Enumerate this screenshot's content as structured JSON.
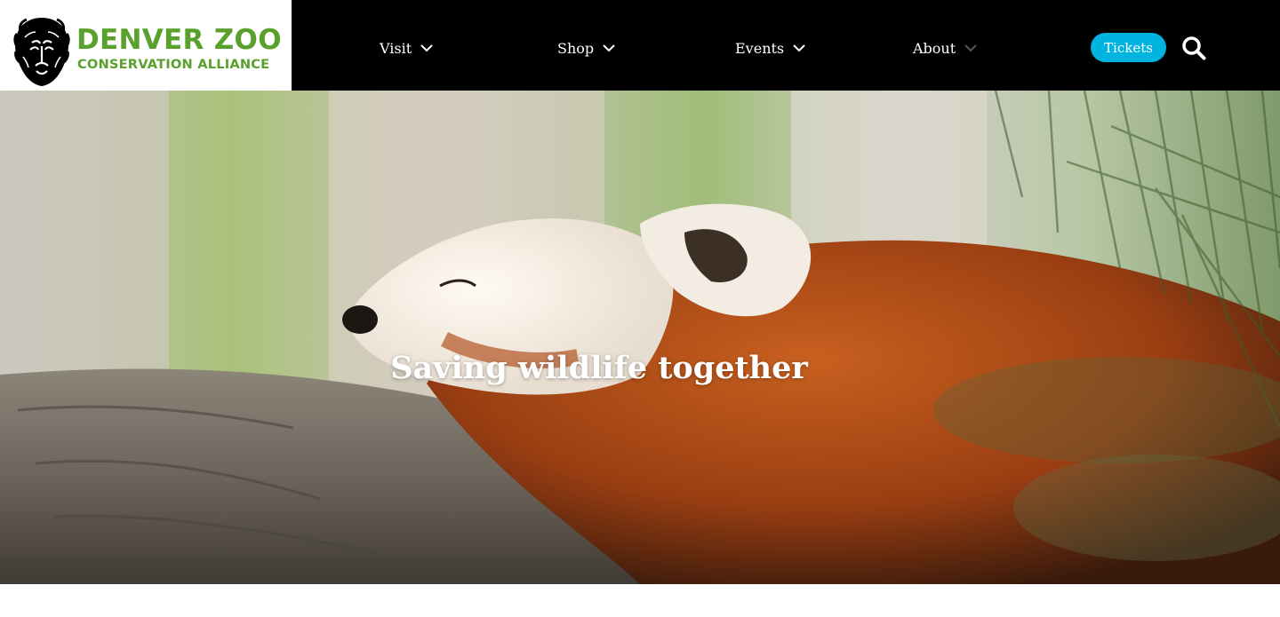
{
  "brand": {
    "name_line1": "DENVER ZOO",
    "name_line2": "CONSERVATION ALLIANCE",
    "logo_icon": "lion-head-icon",
    "color": "#5aa02c"
  },
  "nav": {
    "items": [
      {
        "label": "Visit"
      },
      {
        "label": "Shop"
      },
      {
        "label": "Events"
      },
      {
        "label": "About"
      }
    ],
    "tickets_label": "Tickets",
    "tickets_color": "#00b4e0",
    "search_icon": "search-icon"
  },
  "hero": {
    "title": "Saving wildlife together",
    "image": "sleeping-red-panda-on-branch"
  }
}
